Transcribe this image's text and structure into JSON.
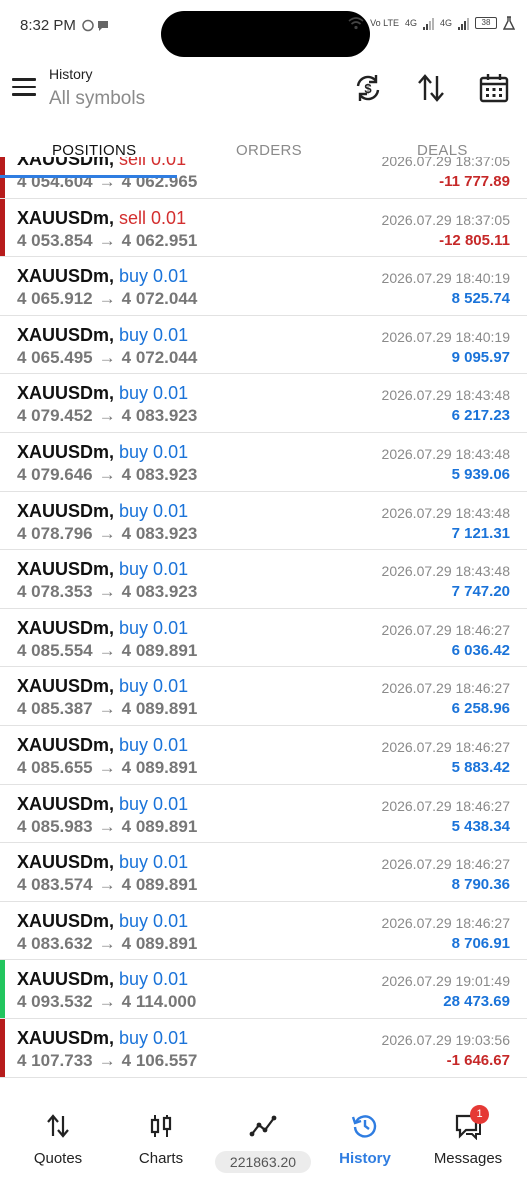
{
  "status_bar": {
    "time": "8:32 PM",
    "network_labels": [
      "Vo LTE",
      "4G",
      "4G"
    ],
    "battery": "38"
  },
  "header": {
    "title": "History",
    "subtitle": "All symbols"
  },
  "tabs": [
    {
      "label": "POSITIONS",
      "active": true
    },
    {
      "label": "ORDERS",
      "active": false
    },
    {
      "label": "DEALS",
      "active": false
    }
  ],
  "colors": {
    "accent": "#2f7de1",
    "buy": "#1a73d9",
    "sell": "#d32f2f",
    "profit_positive": "#1a73d9",
    "profit_negative": "#c62828",
    "bar_loss": "#b71c1c",
    "bar_win": "#22c55e"
  },
  "positions": [
    {
      "symbol": "XAUUSDm,",
      "side": "sell 0.01",
      "side_type": "sell",
      "open": "4 054.604",
      "close": "4 062.965",
      "time": "2026.07.29 18:37:05",
      "profit": "-11 777.89",
      "profit_type": "negative",
      "bar": "loss"
    },
    {
      "symbol": "XAUUSDm,",
      "side": "sell 0.01",
      "side_type": "sell",
      "open": "4 053.854",
      "close": "4 062.951",
      "time": "2026.07.29 18:37:05",
      "profit": "-12 805.11",
      "profit_type": "negative",
      "bar": "loss"
    },
    {
      "symbol": "XAUUSDm,",
      "side": "buy 0.01",
      "side_type": "buy",
      "open": "4 065.912",
      "close": "4 072.044",
      "time": "2026.07.29 18:40:19",
      "profit": "8 525.74",
      "profit_type": "positive",
      "bar": "none"
    },
    {
      "symbol": "XAUUSDm,",
      "side": "buy 0.01",
      "side_type": "buy",
      "open": "4 065.495",
      "close": "4 072.044",
      "time": "2026.07.29 18:40:19",
      "profit": "9 095.97",
      "profit_type": "positive",
      "bar": "none"
    },
    {
      "symbol": "XAUUSDm,",
      "side": "buy 0.01",
      "side_type": "buy",
      "open": "4 079.452",
      "close": "4 083.923",
      "time": "2026.07.29 18:43:48",
      "profit": "6 217.23",
      "profit_type": "positive",
      "bar": "none"
    },
    {
      "symbol": "XAUUSDm,",
      "side": "buy 0.01",
      "side_type": "buy",
      "open": "4 079.646",
      "close": "4 083.923",
      "time": "2026.07.29 18:43:48",
      "profit": "5 939.06",
      "profit_type": "positive",
      "bar": "none"
    },
    {
      "symbol": "XAUUSDm,",
      "side": "buy 0.01",
      "side_type": "buy",
      "open": "4 078.796",
      "close": "4 083.923",
      "time": "2026.07.29 18:43:48",
      "profit": "7 121.31",
      "profit_type": "positive",
      "bar": "none"
    },
    {
      "symbol": "XAUUSDm,",
      "side": "buy 0.01",
      "side_type": "buy",
      "open": "4 078.353",
      "close": "4 083.923",
      "time": "2026.07.29 18:43:48",
      "profit": "7 747.20",
      "profit_type": "positive",
      "bar": "none"
    },
    {
      "symbol": "XAUUSDm,",
      "side": "buy 0.01",
      "side_type": "buy",
      "open": "4 085.554",
      "close": "4 089.891",
      "time": "2026.07.29 18:46:27",
      "profit": "6 036.42",
      "profit_type": "positive",
      "bar": "none"
    },
    {
      "symbol": "XAUUSDm,",
      "side": "buy 0.01",
      "side_type": "buy",
      "open": "4 085.387",
      "close": "4 089.891",
      "time": "2026.07.29 18:46:27",
      "profit": "6 258.96",
      "profit_type": "positive",
      "bar": "none"
    },
    {
      "symbol": "XAUUSDm,",
      "side": "buy 0.01",
      "side_type": "buy",
      "open": "4 085.655",
      "close": "4 089.891",
      "time": "2026.07.29 18:46:27",
      "profit": "5 883.42",
      "profit_type": "positive",
      "bar": "none"
    },
    {
      "symbol": "XAUUSDm,",
      "side": "buy 0.01",
      "side_type": "buy",
      "open": "4 085.983",
      "close": "4 089.891",
      "time": "2026.07.29 18:46:27",
      "profit": "5 438.34",
      "profit_type": "positive",
      "bar": "none"
    },
    {
      "symbol": "XAUUSDm,",
      "side": "buy 0.01",
      "side_type": "buy",
      "open": "4 083.574",
      "close": "4 089.891",
      "time": "2026.07.29 18:46:27",
      "profit": "8 790.36",
      "profit_type": "positive",
      "bar": "none"
    },
    {
      "symbol": "XAUUSDm,",
      "side": "buy 0.01",
      "side_type": "buy",
      "open": "4 083.632",
      "close": "4 089.891",
      "time": "2026.07.29 18:46:27",
      "profit": "8 706.91",
      "profit_type": "positive",
      "bar": "none"
    },
    {
      "symbol": "XAUUSDm,",
      "side": "buy 0.01",
      "side_type": "buy",
      "open": "4 093.532",
      "close": "4 114.000",
      "time": "2026.07.29 19:01:49",
      "profit": "28 473.69",
      "profit_type": "positive",
      "bar": "win"
    },
    {
      "symbol": "XAUUSDm,",
      "side": "buy 0.01",
      "side_type": "buy",
      "open": "4 107.733",
      "close": "4 106.557",
      "time": "2026.07.29 19:03:56",
      "profit": "-1 646.67",
      "profit_type": "negative",
      "bar": "loss"
    }
  ],
  "bottom_nav": {
    "items": [
      {
        "label": "Quotes",
        "icon": "quotes-icon",
        "active": false
      },
      {
        "label": "Charts",
        "icon": "charts-icon",
        "active": false
      },
      {
        "label": "Trade",
        "icon": "trade-icon",
        "active": false
      },
      {
        "label": "History",
        "icon": "history-icon",
        "active": true
      },
      {
        "label": "Messages",
        "icon": "messages-icon",
        "active": false
      }
    ],
    "balance": "221863.20",
    "messages_badge": "1"
  }
}
